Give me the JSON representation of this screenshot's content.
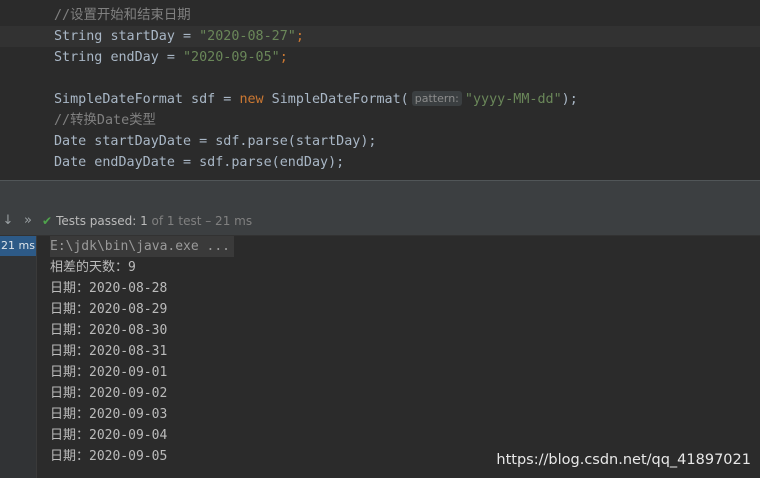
{
  "editor": {
    "line1_comment": "//设置开始和结束日期",
    "line2": {
      "type": "String",
      "name": "startDay",
      "eq": " = ",
      "value": "\"2020-08-27\"",
      "end": ";"
    },
    "line3": {
      "type": "String",
      "name": "endDay",
      "eq": " = ",
      "value": "\"2020-09-05\"",
      "end": ";"
    },
    "line5": {
      "pre": "SimpleDateFormat sdf = ",
      "kw_new": "new",
      "ctor": " SimpleDateFormat(",
      "hint_label": "pattern",
      "hint_colon": ":",
      "value": "\"yyyy-MM-dd\"",
      "end": ");"
    },
    "line6_comment": "//转换Date类型",
    "line7": "Date startDayDate = sdf.parse(startDay);",
    "line8": "Date endDayDate = sdf.parse(endDay);"
  },
  "toolbar": {
    "status_label": "Tests passed: ",
    "passed_count": "1",
    "status_detail": " of 1 test – 21 ms",
    "down_icon": "arrow-down-icon",
    "more_icon": "double-chevron-icon"
  },
  "run": {
    "duration_badge": "21 ms",
    "command": "E:\\jdk\\bin\\java.exe ...",
    "output": [
      "相差的天数：9",
      "日期：2020-08-28",
      "日期：2020-08-29",
      "日期：2020-08-30",
      "日期：2020-08-31",
      "日期：2020-09-01",
      "日期：2020-09-02",
      "日期：2020-09-03",
      "日期：2020-09-04",
      "日期：2020-09-05"
    ]
  },
  "watermark": "https://blog.csdn.net/qq_41897021",
  "colors": {
    "editor_bg": "#2b2b2b",
    "string": "#6a8759",
    "keyword": "#cc7832",
    "comment": "#808080",
    "pass_green": "#4fa34c",
    "badge_blue": "#2d5a87"
  }
}
